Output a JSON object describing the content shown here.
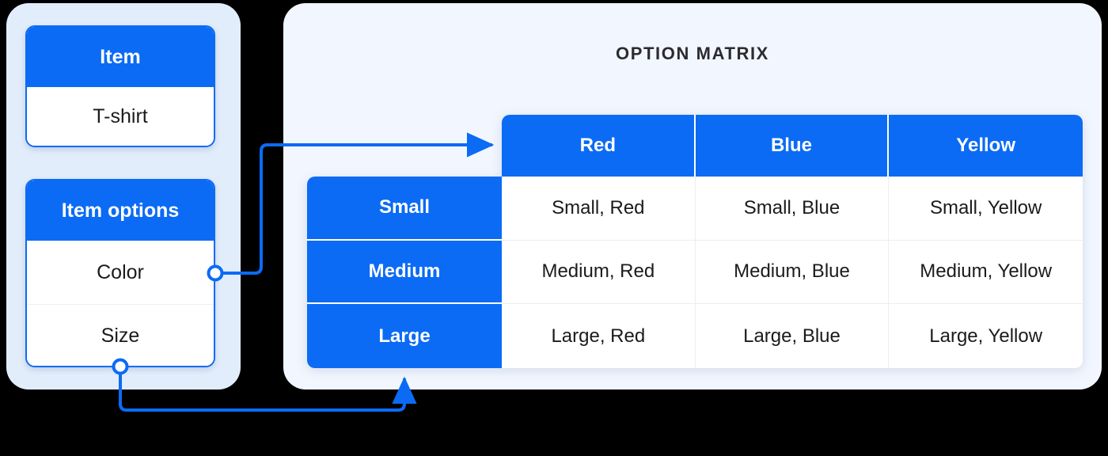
{
  "left_panel": {
    "item_card": {
      "header": "Item",
      "rows": [
        "T-shirt"
      ]
    },
    "options_card": {
      "header": "Item options",
      "rows": [
        "Color",
        "Size"
      ]
    }
  },
  "right_panel": {
    "title": "OPTION MATRIX",
    "matrix": {
      "corner": "",
      "column_headers": [
        "Red",
        "Blue",
        "Yellow"
      ],
      "row_headers": [
        "Small",
        "Medium",
        "Large"
      ],
      "cells": [
        [
          "Small, Red",
          "Small, Blue",
          "Small, Yellow"
        ],
        [
          "Medium, Red",
          "Medium, Blue",
          "Medium, Yellow"
        ],
        [
          "Large, Red",
          "Large, Blue",
          "Large, Yellow"
        ]
      ]
    }
  },
  "connectors": {
    "color_to_columns": "Color -> column headers",
    "size_to_rows": "Size -> row headers"
  },
  "colors": {
    "accent": "#0B6BF5",
    "panel_left_bg": "#E2EDFC",
    "panel_right_bg": "#F2F6FE",
    "card_bg": "#FFFFFF",
    "text": "#1B1B1F",
    "divider": "#EEEEF1"
  }
}
